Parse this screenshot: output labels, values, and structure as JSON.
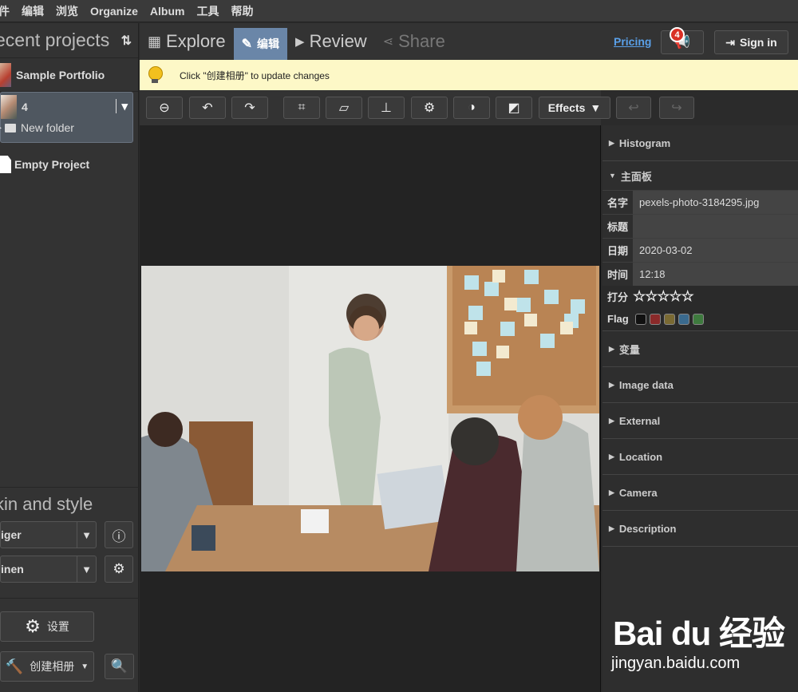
{
  "menu": [
    "件",
    "编辑",
    "浏览",
    "Organize",
    "Album",
    "工具",
    "帮助"
  ],
  "sidebar": {
    "title": "ecent projects",
    "projects": [
      {
        "label": "Sample Portfolio"
      },
      {
        "label": "4",
        "folder": "New folder"
      },
      {
        "label": "Empty Project"
      }
    ],
    "skin_title": "kin and style",
    "skin_select": "iger",
    "style_select": "inen",
    "settings_label": "设置",
    "create_album_label": "创建相册"
  },
  "tabs": {
    "explore": "Explore",
    "edit": "编辑",
    "review": "Review",
    "share": "Share"
  },
  "header": {
    "pricing": "Pricing",
    "notification_count": "4",
    "sign_in": "Sign in"
  },
  "notice": {
    "text": "Click \"创建相册\" to update changes"
  },
  "toolbar": {
    "effects": "Effects"
  },
  "panel": {
    "histogram": "Histogram",
    "main_panel": "主面板",
    "fields": [
      {
        "label": "名字",
        "value": "pexels-photo-3184295.jpg"
      },
      {
        "label": "标题",
        "value": ""
      },
      {
        "label": "日期",
        "value": "2020-03-02"
      },
      {
        "label": "时间",
        "value": "12:18"
      }
    ],
    "rating_label": "打分",
    "rating_value": "☆☆☆☆☆",
    "flag_label": "Flag",
    "flag_colors": [
      "#111111",
      "#8b2a2a",
      "#7a6a33",
      "#3a6a8e",
      "#3e7a3e"
    ],
    "sections": [
      "变量",
      "Image data",
      "External",
      "Location",
      "Camera",
      "Description"
    ]
  },
  "watermark": {
    "brand": "Bai du 经验",
    "url": "jingyan.baidu.com"
  }
}
